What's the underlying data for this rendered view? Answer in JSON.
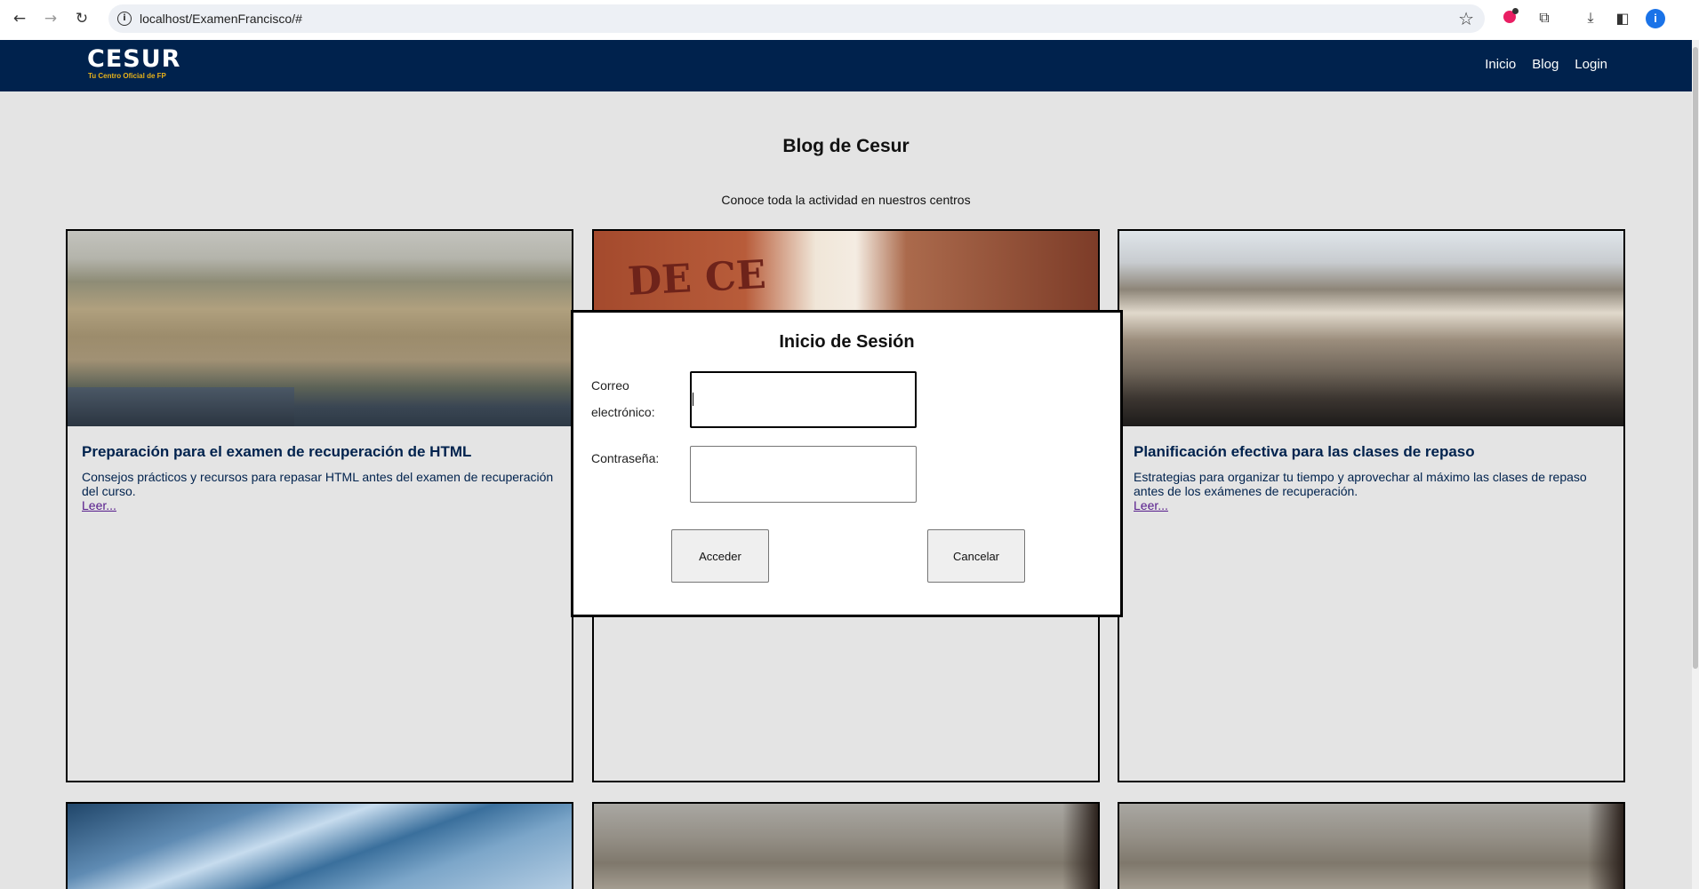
{
  "browser": {
    "url": "localhost/ExamenFrancisco/#",
    "profile_initial": "i"
  },
  "header": {
    "logo": "CESUR",
    "tagline": "Tu Centro Oficial de FP",
    "nav": [
      "Inicio",
      "Blog",
      "Login"
    ]
  },
  "page": {
    "title": "Blog de Cesur",
    "subtitle": "Conoce toda la actividad en nuestros centros"
  },
  "cards": [
    {
      "title": "Preparación para el examen de recuperación de HTML",
      "text": "Consejos prácticos y recursos para repasar HTML antes del examen de recuperación del curso.",
      "link": "Leer..."
    },
    {
      "image_text": "DE CE",
      "title": "",
      "text": "",
      "link": ""
    },
    {
      "title": "Planificación efectiva para las clases de repaso",
      "text": "Estrategias para organizar tu tiempo y aprovechar al máximo las clases de repaso antes de los exámenes de recuperación.",
      "link": "Leer..."
    }
  ],
  "modal": {
    "title": "Inicio de Sesión",
    "email_label_line1": "Correo",
    "email_label_line2": "electrónico:",
    "email_value": "",
    "password_label": "Contraseña:",
    "password_value": "",
    "submit": "Acceder",
    "cancel": "Cancelar"
  },
  "colors": {
    "header_bg": "#00224d",
    "page_bg": "#e4e4e4",
    "card_title": "#00224d",
    "link_visited": "#551a8b",
    "logo_tagline": "#e7b21a"
  }
}
